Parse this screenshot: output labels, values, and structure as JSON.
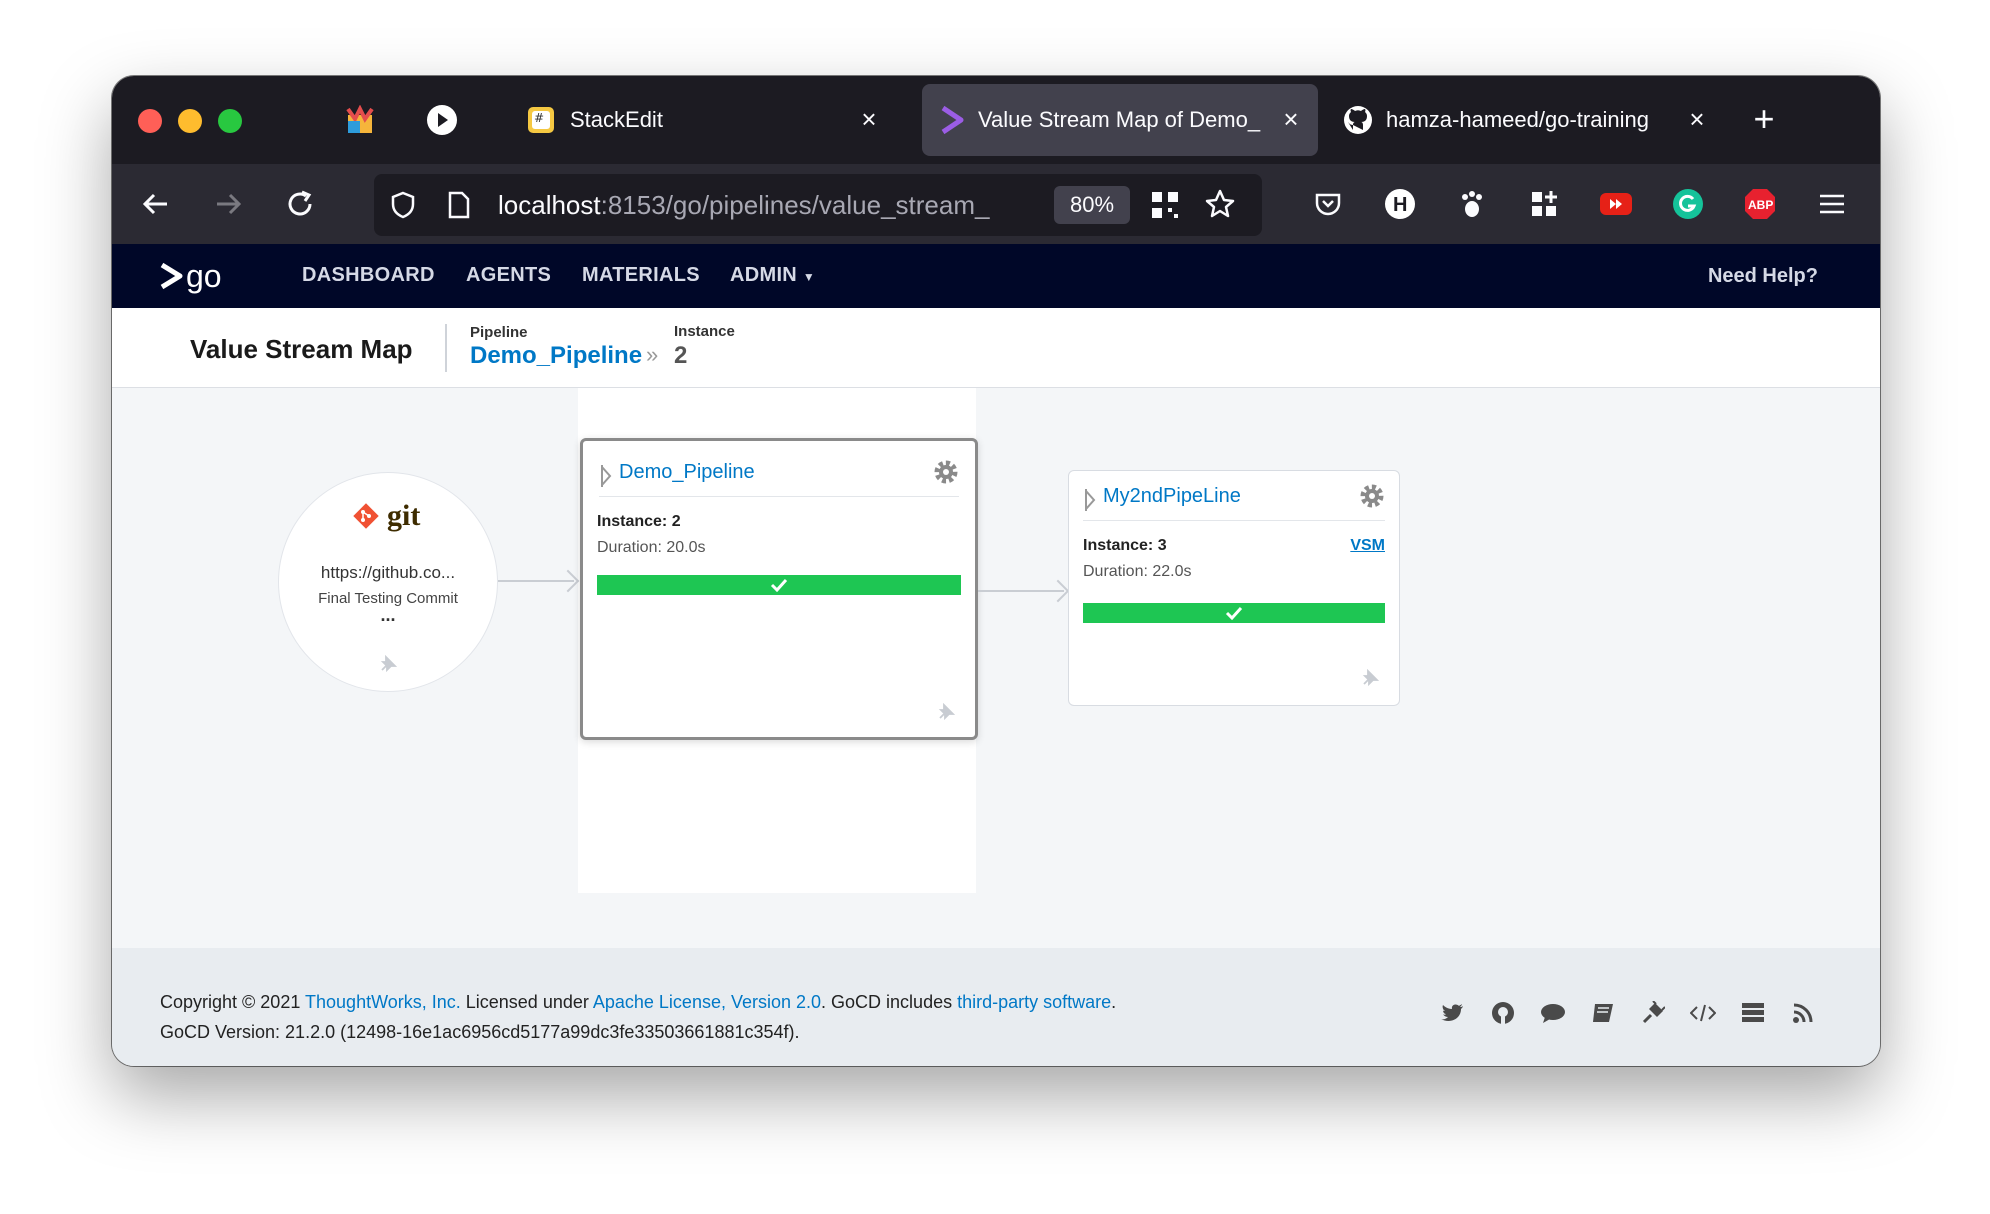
{
  "browser": {
    "tabs": [
      {
        "title": "StackEdit",
        "icon": "stackedit-icon"
      },
      {
        "title": "Value Stream Map of Demo_",
        "icon": "gocd-icon",
        "active": true
      },
      {
        "title": "hamza-hameed/go-training",
        "icon": "github-icon"
      }
    ],
    "url_host": "localhost",
    "url_path": ":8153/go/pipelines/value_stream_",
    "zoom": "80%"
  },
  "nav": {
    "logo": "go",
    "items": [
      "DASHBOARD",
      "AGENTS",
      "MATERIALS",
      "ADMIN"
    ],
    "help": "Need Help?"
  },
  "header": {
    "title": "Value Stream Map",
    "pipeline_label": "Pipeline",
    "pipeline_name": "Demo_Pipeline",
    "instance_label": "Instance",
    "instance_value": "2"
  },
  "material": {
    "type": "git",
    "url": "https://github.co...",
    "commit": "Final Testing Commit",
    "more": "..."
  },
  "pipelines": [
    {
      "name": "Demo_Pipeline",
      "instance": "Instance: 2",
      "duration": "Duration: 20.0s",
      "status": "passed"
    },
    {
      "name": "My2ndPipeLine",
      "instance": "Instance: 3",
      "duration": "Duration: 22.0s",
      "vsm": "VSM",
      "status": "passed"
    }
  ],
  "footer": {
    "copyright_prefix": "Copyright © 2021 ",
    "company": "ThoughtWorks, Inc.",
    "licensed": " Licensed under ",
    "license": "Apache License, Version 2.0",
    "includes": ". GoCD includes ",
    "third_party": "third-party software",
    "period": ".",
    "version": "GoCD Version: 21.2.0 (12498-16e1ac6956cd5177a99dc3fe33503661881c354f)."
  },
  "colors": {
    "nav_bg": "#000728",
    "link": "#0078c6",
    "success": "#1ec653"
  }
}
